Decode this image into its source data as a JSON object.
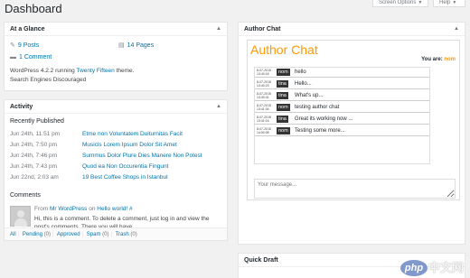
{
  "page_title": "Dashboard",
  "screen_options_label": "Screen Options",
  "help_label": "Help",
  "at_a_glance": {
    "title": "At a Glance",
    "posts": "9 Posts",
    "pages": "14 Pages",
    "comments": "1 Comment",
    "version_prefix": "WordPress 4.2.2 running",
    "theme_link": "Twenty Fifteen",
    "theme_suffix": "theme.",
    "search_engines": "Search Engines Discouraged"
  },
  "activity": {
    "title": "Activity",
    "recently_published_label": "Recently Published",
    "published": [
      {
        "date": "Jun 24th, 11:51 pm",
        "title": "Etme non Voluntatem Duiturnitas Facit"
      },
      {
        "date": "Jun 24th, 7:50 pm",
        "title": "Musicis Lorem Ipsum Dolor Sit Amet"
      },
      {
        "date": "Jun 24th, 7:46 pm",
        "title": "Summus Dolor Plure Dies Manere Non Potest"
      },
      {
        "date": "Jun 24th, 7:43 pm",
        "title": "Quod ea Non Occurentia Fingunt"
      },
      {
        "date": "Jun 22nd, 2:03 am",
        "title": "19 Best Coffee Shops in Istanbul"
      }
    ],
    "comments_label": "Comments",
    "comment": {
      "from_label": "From",
      "author": "Mr WordPress",
      "on_label": "on",
      "post": "Hello world! #",
      "text": "Hi, this is a comment. To delete a comment, just log in and view the post's comments. There you will have ..."
    },
    "filters": [
      {
        "label": "All",
        "count": ""
      },
      {
        "label": "Pending",
        "count": "(0)"
      },
      {
        "label": "Approved",
        "count": ""
      },
      {
        "label": "Spam",
        "count": "(0)"
      },
      {
        "label": "Trash",
        "count": "(0)"
      }
    ]
  },
  "author_chat": {
    "box_title": "Author Chat",
    "heading": "Author Chat",
    "you_are_label": "You are:",
    "you_are_user": "nom",
    "messages": [
      {
        "time": "8-07-2015 13:40:16",
        "user": "nom",
        "text": "hello"
      },
      {
        "time": "8-07-2015 13:40:23",
        "user": "tina",
        "text": "Hello..."
      },
      {
        "time": "8-07-2015 13:40:31",
        "user": "tina",
        "text": "What's up..."
      },
      {
        "time": "8-07-2015 13:41:04",
        "user": "nom",
        "text": "testing author chat"
      },
      {
        "time": "8-07-2015 13:41:16",
        "user": "tina",
        "text": "Great its working now ..."
      },
      {
        "time": "8-07-2015 14:50:08",
        "user": "nom",
        "text": "Testing some more..."
      }
    ],
    "input_placeholder": "Your message..."
  },
  "quick_draft": {
    "title": "Quick Draft"
  },
  "watermark": {
    "logo_text": "php",
    "cn_text": "中文网"
  },
  "icons": {
    "toggle": "triangle-up-icon",
    "posts": "pushpin-icon",
    "pages": "pages-icon",
    "comments": "speech-bubble-icon"
  }
}
